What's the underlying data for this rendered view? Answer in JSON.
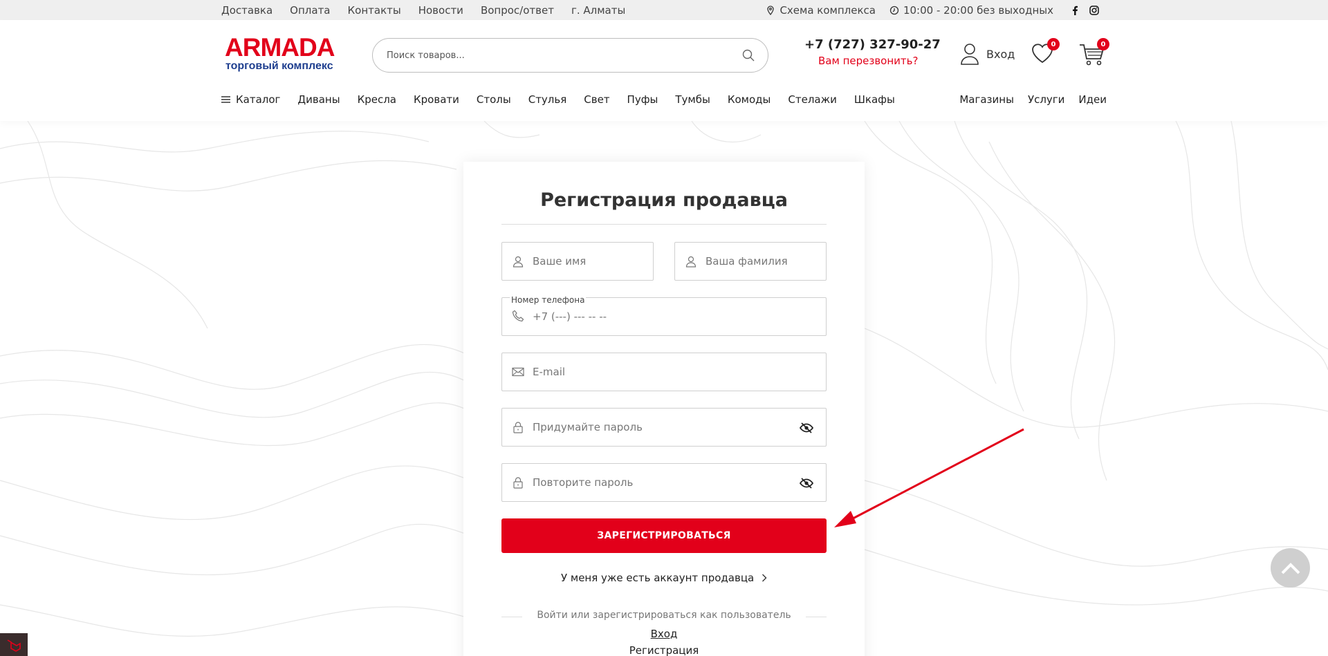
{
  "topbar": {
    "links": [
      "Доставка",
      "Оплата",
      "Контакты",
      "Новости",
      "Вопрос/ответ",
      "г. Алматы"
    ],
    "scheme": "Схема комплекса",
    "hours": "10:00 - 20:00 без выходных"
  },
  "header": {
    "logo_brand": "ARMADA",
    "logo_sub": "торговый комплекс",
    "search_placeholder": "Поиск товаров...",
    "phone": "+7 (727) 327-90-27",
    "callback": "Вам перезвонить?",
    "login": "Вход",
    "fav_count": "0",
    "cart_count": "0"
  },
  "nav": {
    "catalog": "Каталог",
    "items": [
      "Диваны",
      "Кресла",
      "Кровати",
      "Столы",
      "Стулья",
      "Свет",
      "Пуфы",
      "Тумбы",
      "Комоды",
      "Стелажи",
      "Шкафы"
    ],
    "right": [
      "Магазины",
      "Услуги",
      "Идеи"
    ]
  },
  "form": {
    "title": "Регистрация продавца",
    "first_name_placeholder": "Ваше имя",
    "last_name_placeholder": "Ваша фамилия",
    "phone_label": "Номер телефона",
    "phone_placeholder": "+7 (---) --- -- --",
    "email_placeholder": "E-mail",
    "password_placeholder": "Придумайте пароль",
    "password_repeat_placeholder": "Повторите пароль",
    "submit": "ЗАРЕГИСТРИРОВАТЬСЯ",
    "have_account": "У меня уже есть аккаунт продавца",
    "or_text": "Войти или зарегистрироваться как пользователь",
    "login_link": "Вход",
    "register_link": "Регистрация"
  },
  "colors": {
    "accent": "#e2001a",
    "logo_sub": "#1f3f8f"
  }
}
